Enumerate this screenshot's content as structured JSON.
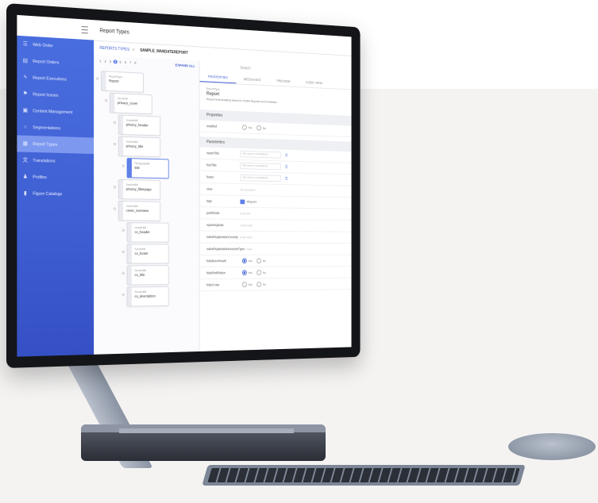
{
  "sidebar": {
    "items": [
      {
        "label": "Web Order",
        "icon": "list-icon"
      },
      {
        "label": "Report Orders",
        "icon": "orders-icon"
      },
      {
        "label": "Report Executions",
        "icon": "bolt-icon"
      },
      {
        "label": "Report Issues",
        "icon": "flag-icon"
      },
      {
        "label": "Content Management",
        "icon": "content-icon"
      },
      {
        "label": "Segmentations",
        "icon": "circle-icon"
      },
      {
        "label": "Report Types",
        "icon": "report-icon",
        "active": true
      },
      {
        "label": "Translations",
        "icon": "translate-icon"
      },
      {
        "label": "Profiles",
        "icon": "profile-icon"
      },
      {
        "label": "Figure Catalogs",
        "icon": "catalog-icon"
      }
    ]
  },
  "header": {
    "title": "Report Types"
  },
  "breadcrumb": {
    "root": "REPORTS TYPES",
    "separator": ">",
    "current": "SAMPLE_MANDATEREPORT"
  },
  "tree": {
    "pages": [
      "1",
      "2",
      "3",
      "4",
      "5",
      "6",
      "7",
      "8"
    ],
    "current_page": "4",
    "expand_label": "EXPAND ALL",
    "nodes": [
      {
        "type": "ReportType",
        "name": "Report"
      },
      {
        "type": "SectionB",
        "name": "privacy_cover"
      },
      {
        "type": "HeaderBB",
        "name": "privacy_header"
      },
      {
        "type": "SectionBB",
        "name": "privacy_title"
      },
      {
        "type": "ParagraphBB",
        "name": "title",
        "selected": true
      },
      {
        "type": "SectionBB",
        "name": "privacy_filterpage"
      },
      {
        "type": "SectionBB",
        "name": "cover_overview"
      },
      {
        "type": "HeaderBB",
        "name": "co_header"
      },
      {
        "type": "FooterBB",
        "name": "co_footer"
      },
      {
        "type": "SectionBB",
        "name": "co_title"
      },
      {
        "type": "SectionBB",
        "name": "co_description"
      }
    ]
  },
  "detail": {
    "search_placeholder": "Search",
    "tabs": [
      "PROPERTIES",
      "MESSAGES",
      "PREVIEW",
      "CODE VIEW"
    ],
    "type_label": "ReportType",
    "name": "Report",
    "description": "Report level building block for CDAR Reports and Portfolios",
    "properties_title": "Properties",
    "enabled_label": "enabled",
    "yes_label": "Yes",
    "no_label": "No",
    "parameters_title": "Parameters",
    "parameters": [
      {
        "label": "reportTitle",
        "value": "Add value to translations",
        "kind": "input"
      },
      {
        "label": "footTitle",
        "value": "Add value to translations",
        "kind": "input"
      },
      {
        "label": "footer",
        "value": "Add value to translations",
        "kind": "input"
      },
      {
        "label": "view",
        "value": "No description",
        "kind": "plain"
      },
      {
        "label": "tags",
        "value": "#Report1",
        "kind": "tag"
      },
      {
        "label": "portfolioID",
        "value": "Enter text",
        "kind": "plain"
      },
      {
        "label": "reportingDate",
        "value": "Select Date",
        "kind": "plain"
      },
      {
        "label": "salesRegistrationCountry",
        "value": "Enter Value",
        "kind": "plain"
      },
      {
        "label": "salesRegistrationInvestorType",
        "value": "Enter Value",
        "kind": "plain"
      },
      {
        "label": "hideBenchmark",
        "kind": "radio",
        "selected": "Yes"
      },
      {
        "label": "hideRiskRation",
        "kind": "radio",
        "selected": "Yes"
      },
      {
        "label": "hideCross",
        "kind": "radio",
        "selected": ""
      }
    ]
  },
  "colors": {
    "accent": "#3f5fd2",
    "sidebar": "#4a6fe0",
    "active": "#7d98ef"
  }
}
